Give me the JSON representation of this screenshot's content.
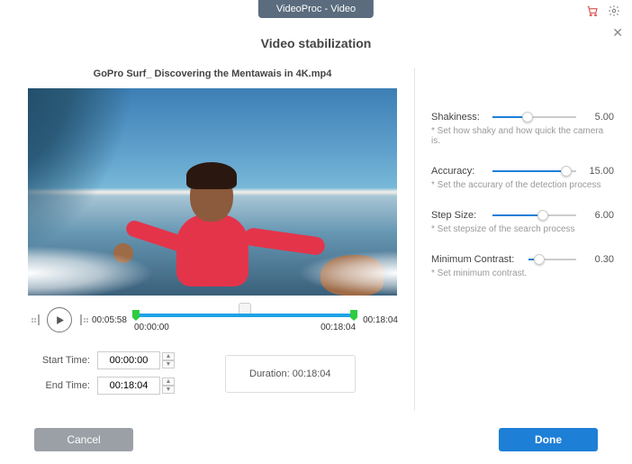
{
  "app_title": "VideoProc - Video",
  "page_title": "Video stabilization",
  "file_name": "GoPro Surf_ Discovering the Mentawais in 4K.mp4",
  "timeline": {
    "pos_time": "00:05:58",
    "total_time": "00:18:04",
    "range_start": "00:00:00",
    "range_end": "00:18:04"
  },
  "time_section": {
    "start_label": "Start Time:",
    "end_label": "End Time:",
    "start_value": "00:00:00",
    "end_value": "00:18:04",
    "duration_label": "Duration:",
    "duration_value": "00:18:04"
  },
  "sliders": {
    "shakiness": {
      "label": "Shakiness:",
      "value": "5.00",
      "pct": 42,
      "hint": "* Set how shaky and how quick the camera is."
    },
    "accuracy": {
      "label": "Accuracy:",
      "value": "15.00",
      "pct": 88,
      "hint": "* Set the accurary of the detection process"
    },
    "stepsize": {
      "label": "Step Size:",
      "value": "6.00",
      "pct": 60,
      "hint": "* Set stepsize of the search process"
    },
    "contrast": {
      "label": "Minimum Contrast:",
      "value": "0.30",
      "pct": 22,
      "hint": "* Set minimum contrast."
    }
  },
  "buttons": {
    "cancel": "Cancel",
    "done": "Done"
  }
}
